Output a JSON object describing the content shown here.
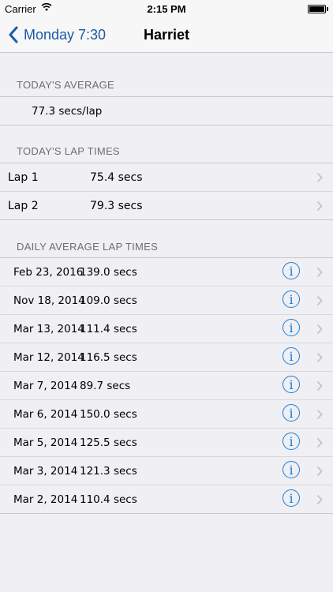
{
  "status": {
    "carrier": "Carrier",
    "time": "2:15 PM"
  },
  "nav": {
    "back_label": "Monday 7:30",
    "title": "Harriet"
  },
  "today_average": {
    "header": "TODAY'S AVERAGE",
    "value": "77.3 secs/lap"
  },
  "lap_times": {
    "header": "TODAY'S LAP TIMES",
    "items": [
      {
        "name": "Lap 1",
        "value": "75.4 secs"
      },
      {
        "name": "Lap 2",
        "value": "79.3 secs"
      }
    ]
  },
  "daily": {
    "header": "DAILY AVERAGE LAP TIMES",
    "items": [
      {
        "date": "Feb 23, 2016",
        "value": "139.0 secs"
      },
      {
        "date": "Nov 18, 2014",
        "value": "109.0 secs"
      },
      {
        "date": "Mar 13, 2014",
        "value": "111.4 secs"
      },
      {
        "date": "Mar 12, 2014",
        "value": "116.5 secs"
      },
      {
        "date": "Mar 7, 2014",
        "value": "89.7 secs"
      },
      {
        "date": "Mar 6, 2014",
        "value": "150.0 secs"
      },
      {
        "date": "Mar 5, 2014",
        "value": "125.5 secs"
      },
      {
        "date": "Mar 3, 2014",
        "value": "121.3 secs"
      },
      {
        "date": "Mar 2, 2014",
        "value": "110.4 secs"
      }
    ]
  },
  "icons": {
    "info": "info-icon",
    "chevron": "chevron-right-icon",
    "back": "chevron-left-icon"
  },
  "colors": {
    "tint": "#1b5aa8",
    "info": "#1b7ed6"
  }
}
